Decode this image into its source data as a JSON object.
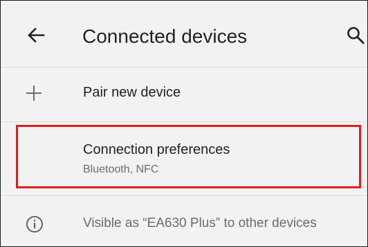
{
  "header": {
    "title": "Connected devices",
    "back_icon": "arrow-back-icon",
    "search_icon": "search-icon"
  },
  "items": [
    {
      "icon": "plus-icon",
      "title": "Pair new device"
    },
    {
      "title": "Connection preferences",
      "summary": "Bluetooth, NFC"
    }
  ],
  "footer": {
    "icon": "info-icon",
    "text": "Visible as “EA630 Plus” to other devices"
  },
  "colors": {
    "background": "#f2f2f2",
    "text_primary": "#202124",
    "text_secondary": "#6b6b6b",
    "highlight": "#e01b1b"
  }
}
